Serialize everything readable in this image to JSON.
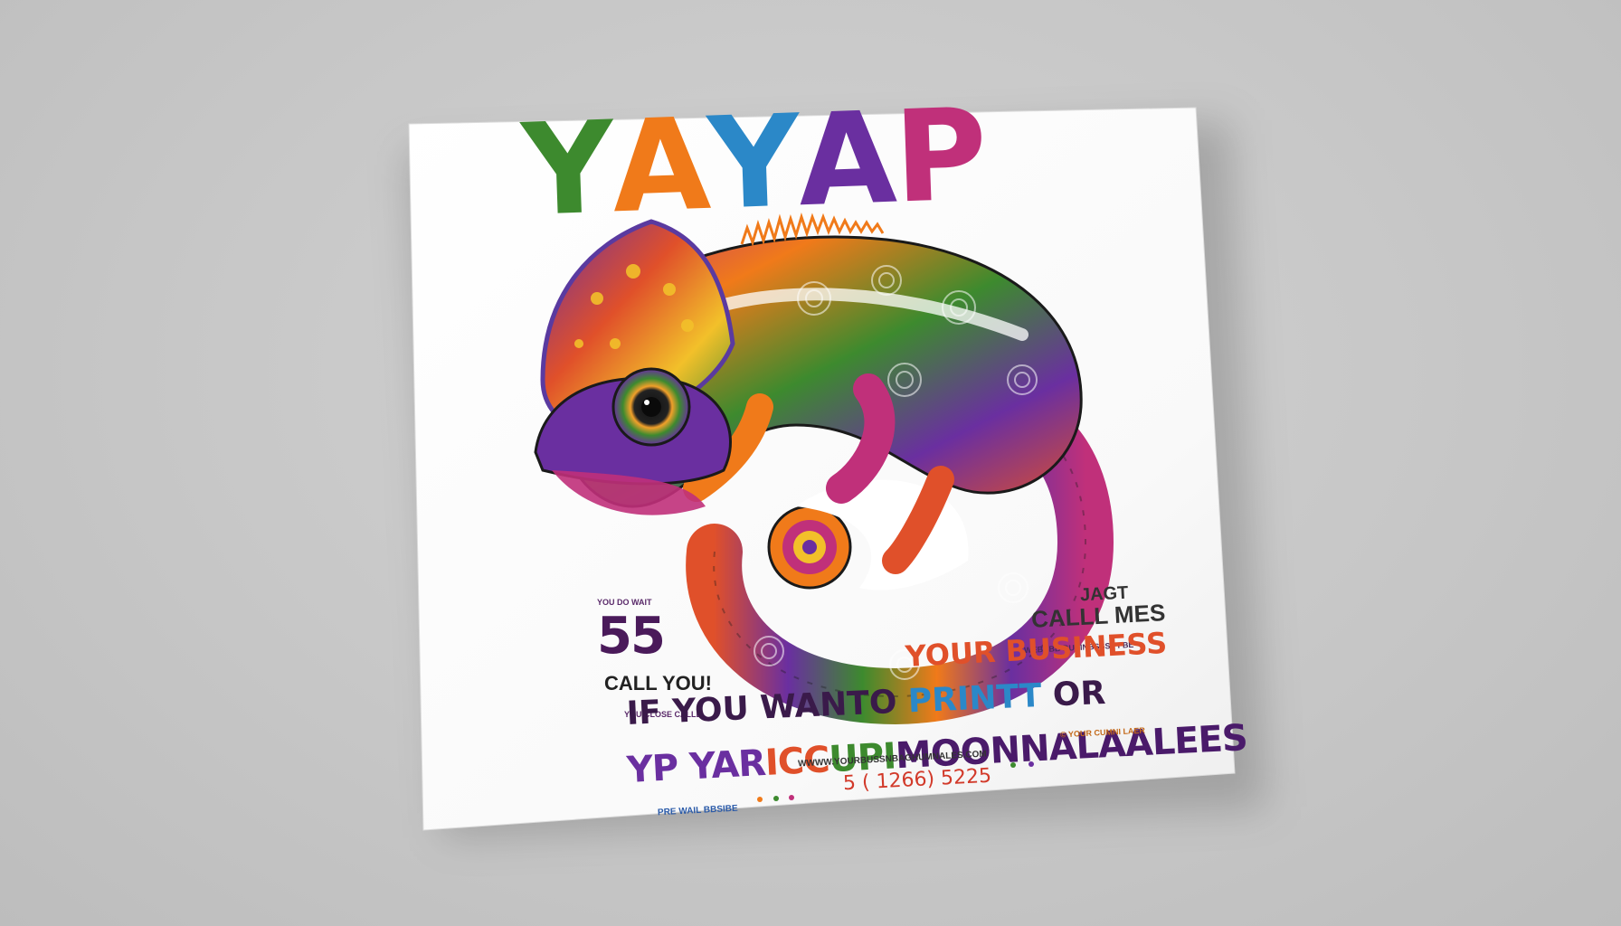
{
  "flyer": {
    "title_letters": [
      {
        "char": "Y",
        "color": "#3d8a2e"
      },
      {
        "char": "A",
        "color": "#f07a1a"
      },
      {
        "char": "Y",
        "color": "#2b88c8"
      },
      {
        "char": "A",
        "color": "#6a2fa0"
      },
      {
        "char": "P",
        "color": "#c0307a"
      }
    ],
    "left_block": {
      "small_top": "YOU DO WAIT",
      "big_number": "55",
      "call_you": "CALL YOU!",
      "small_bottom": "YOU CLOSE CALLL"
    },
    "right_block": {
      "jast": "JAGT",
      "call_mes": "CALLL MES",
      "small_line": "WEBBBB BUSINBSSS FFBE"
    },
    "business_line": [
      {
        "text": "YOUR BUSINESS",
        "color": "#e0502a"
      }
    ],
    "want_line": [
      {
        "text": "IF YOU WANTO ",
        "color": "#3a1a4a"
      },
      {
        "text": "PRINTT",
        "color": "#2b88c8"
      },
      {
        "text": " OR ",
        "color": "#3a1a4a"
      }
    ],
    "yp_line": [
      {
        "text": "YP ",
        "color": "#6a2fa0"
      },
      {
        "text": "YAR",
        "color": "#6a2fa0"
      },
      {
        "text": "ICC",
        "color": "#e0502a"
      },
      {
        "text": "UPI",
        "color": "#3d8a2e"
      },
      {
        "text": "MOONNALAALEES",
        "color": "#4a1a6a"
      }
    ],
    "website": "WWWW.YOURBUSSNBAGHUMNALES.COM",
    "phone": "5 ( 1266) 5225",
    "footer_small": "PRE WAIL BBSIBE",
    "corner_small": "© YOUR CUMNI LAER"
  }
}
